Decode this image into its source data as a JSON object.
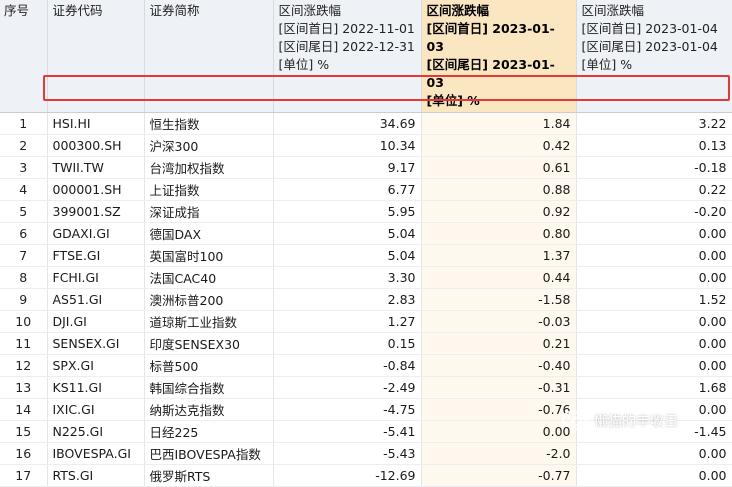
{
  "headers": {
    "seq": "序号",
    "code": "证券代码",
    "name": "证券简称",
    "col1": [
      "区间涨跌幅",
      "[区间首日] 2022-11-01",
      "[区间尾日] 2022-12-31",
      "[单位] %"
    ],
    "col2": [
      "区间涨跌幅",
      "[区间首日] 2023-01-03",
      "[区间尾日] 2023-01-03",
      "[单位] %"
    ],
    "col3": [
      "区间涨跌幅",
      "[区间首日] 2023-01-04",
      "[区间尾日] 2023-01-04",
      "[单位] %"
    ]
  },
  "rows": [
    {
      "idx": "1",
      "code": "HSI.HI",
      "name": "恒生指数",
      "v1": "34.69",
      "v2": "1.84",
      "v3": "3.22"
    },
    {
      "idx": "2",
      "code": "000300.SH",
      "name": "沪深300",
      "v1": "10.34",
      "v2": "0.42",
      "v3": "0.13"
    },
    {
      "idx": "3",
      "code": "TWII.TW",
      "name": "台湾加权指数",
      "v1": "9.17",
      "v2": "0.61",
      "v3": "-0.18"
    },
    {
      "idx": "4",
      "code": "000001.SH",
      "name": "上证指数",
      "v1": "6.77",
      "v2": "0.88",
      "v3": "0.22"
    },
    {
      "idx": "5",
      "code": "399001.SZ",
      "name": "深证成指",
      "v1": "5.95",
      "v2": "0.92",
      "v3": "-0.20"
    },
    {
      "idx": "6",
      "code": "GDAXI.GI",
      "name": "德国DAX",
      "v1": "5.04",
      "v2": "0.80",
      "v3": "0.00"
    },
    {
      "idx": "7",
      "code": "FTSE.GI",
      "name": "英国富时100",
      "v1": "5.04",
      "v2": "1.37",
      "v3": "0.00"
    },
    {
      "idx": "8",
      "code": "FCHI.GI",
      "name": "法国CAC40",
      "v1": "3.30",
      "v2": "0.44",
      "v3": "0.00"
    },
    {
      "idx": "9",
      "code": "AS51.GI",
      "name": "澳洲标普200",
      "v1": "2.83",
      "v2": "-1.58",
      "v3": "1.52"
    },
    {
      "idx": "10",
      "code": "DJI.GI",
      "name": "道琼斯工业指数",
      "v1": "1.27",
      "v2": "-0.03",
      "v3": "0.00"
    },
    {
      "idx": "11",
      "code": "SENSEX.GI",
      "name": "印度SENSEX30",
      "v1": "0.15",
      "v2": "0.21",
      "v3": "0.00"
    },
    {
      "idx": "12",
      "code": "SPX.GI",
      "name": "标普500",
      "v1": "-0.84",
      "v2": "-0.40",
      "v3": "0.00"
    },
    {
      "idx": "13",
      "code": "KS11.GI",
      "name": "韩国综合指数",
      "v1": "-2.49",
      "v2": "-0.31",
      "v3": "1.68"
    },
    {
      "idx": "14",
      "code": "IXIC.GI",
      "name": "纳斯达克指数",
      "v1": "-4.75",
      "v2": "-0.76",
      "v3": "0.00"
    },
    {
      "idx": "15",
      "code": "N225.GI",
      "name": "日经225",
      "v1": "-5.41",
      "v2": "0.00",
      "v3": "-1.45"
    },
    {
      "idx": "16",
      "code": "IBOVESPA.GI",
      "name": "巴西IBOVESPA指数",
      "v1": "-5.43",
      "v2": "-2.0",
      "v3": "0.00"
    },
    {
      "idx": "17",
      "code": "RTS.GI",
      "name": "俄罗斯RTS",
      "v1": "-12.69",
      "v2": "-0.77",
      "v3": "0.00"
    }
  ],
  "watermark": {
    "text": "懒猫的丰收日",
    "icon": "wechat-icon"
  }
}
